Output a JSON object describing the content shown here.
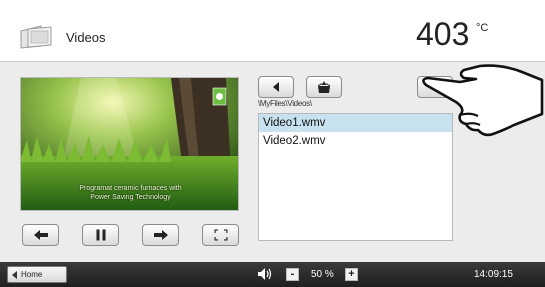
{
  "header": {
    "icon": "film-folder-icon",
    "title": "Videos",
    "temperature": "403",
    "temperature_unit": "°C"
  },
  "video": {
    "overlay_line1": "Programat ceramic furnaces with",
    "overlay_line2": "Power Saving Technology",
    "controls": [
      {
        "name": "previous",
        "icon": "arrow-left-icon"
      },
      {
        "name": "pause",
        "icon": "pause-icon"
      },
      {
        "name": "next",
        "icon": "arrow-right-icon"
      },
      {
        "name": "fullscreen",
        "icon": "fullscreen-icon"
      }
    ]
  },
  "browser": {
    "path": "\\MyFiles\\Videos\\",
    "back_icon": "back-arrow-icon",
    "open_icon": "open-folder-icon",
    "files": [
      "Video1.wmv",
      "Video2.wmv"
    ],
    "selected_index": 0
  },
  "footer": {
    "home_label": "Home",
    "volume_minus": "-",
    "volume_plus": "+",
    "volume_value": "50 %",
    "time": "14:09:15"
  },
  "colors": {
    "selected_row": "#c7e1ee",
    "panel": "#ececec",
    "footer": "#2b2b2b",
    "brand_badge": "#6fbe44"
  }
}
